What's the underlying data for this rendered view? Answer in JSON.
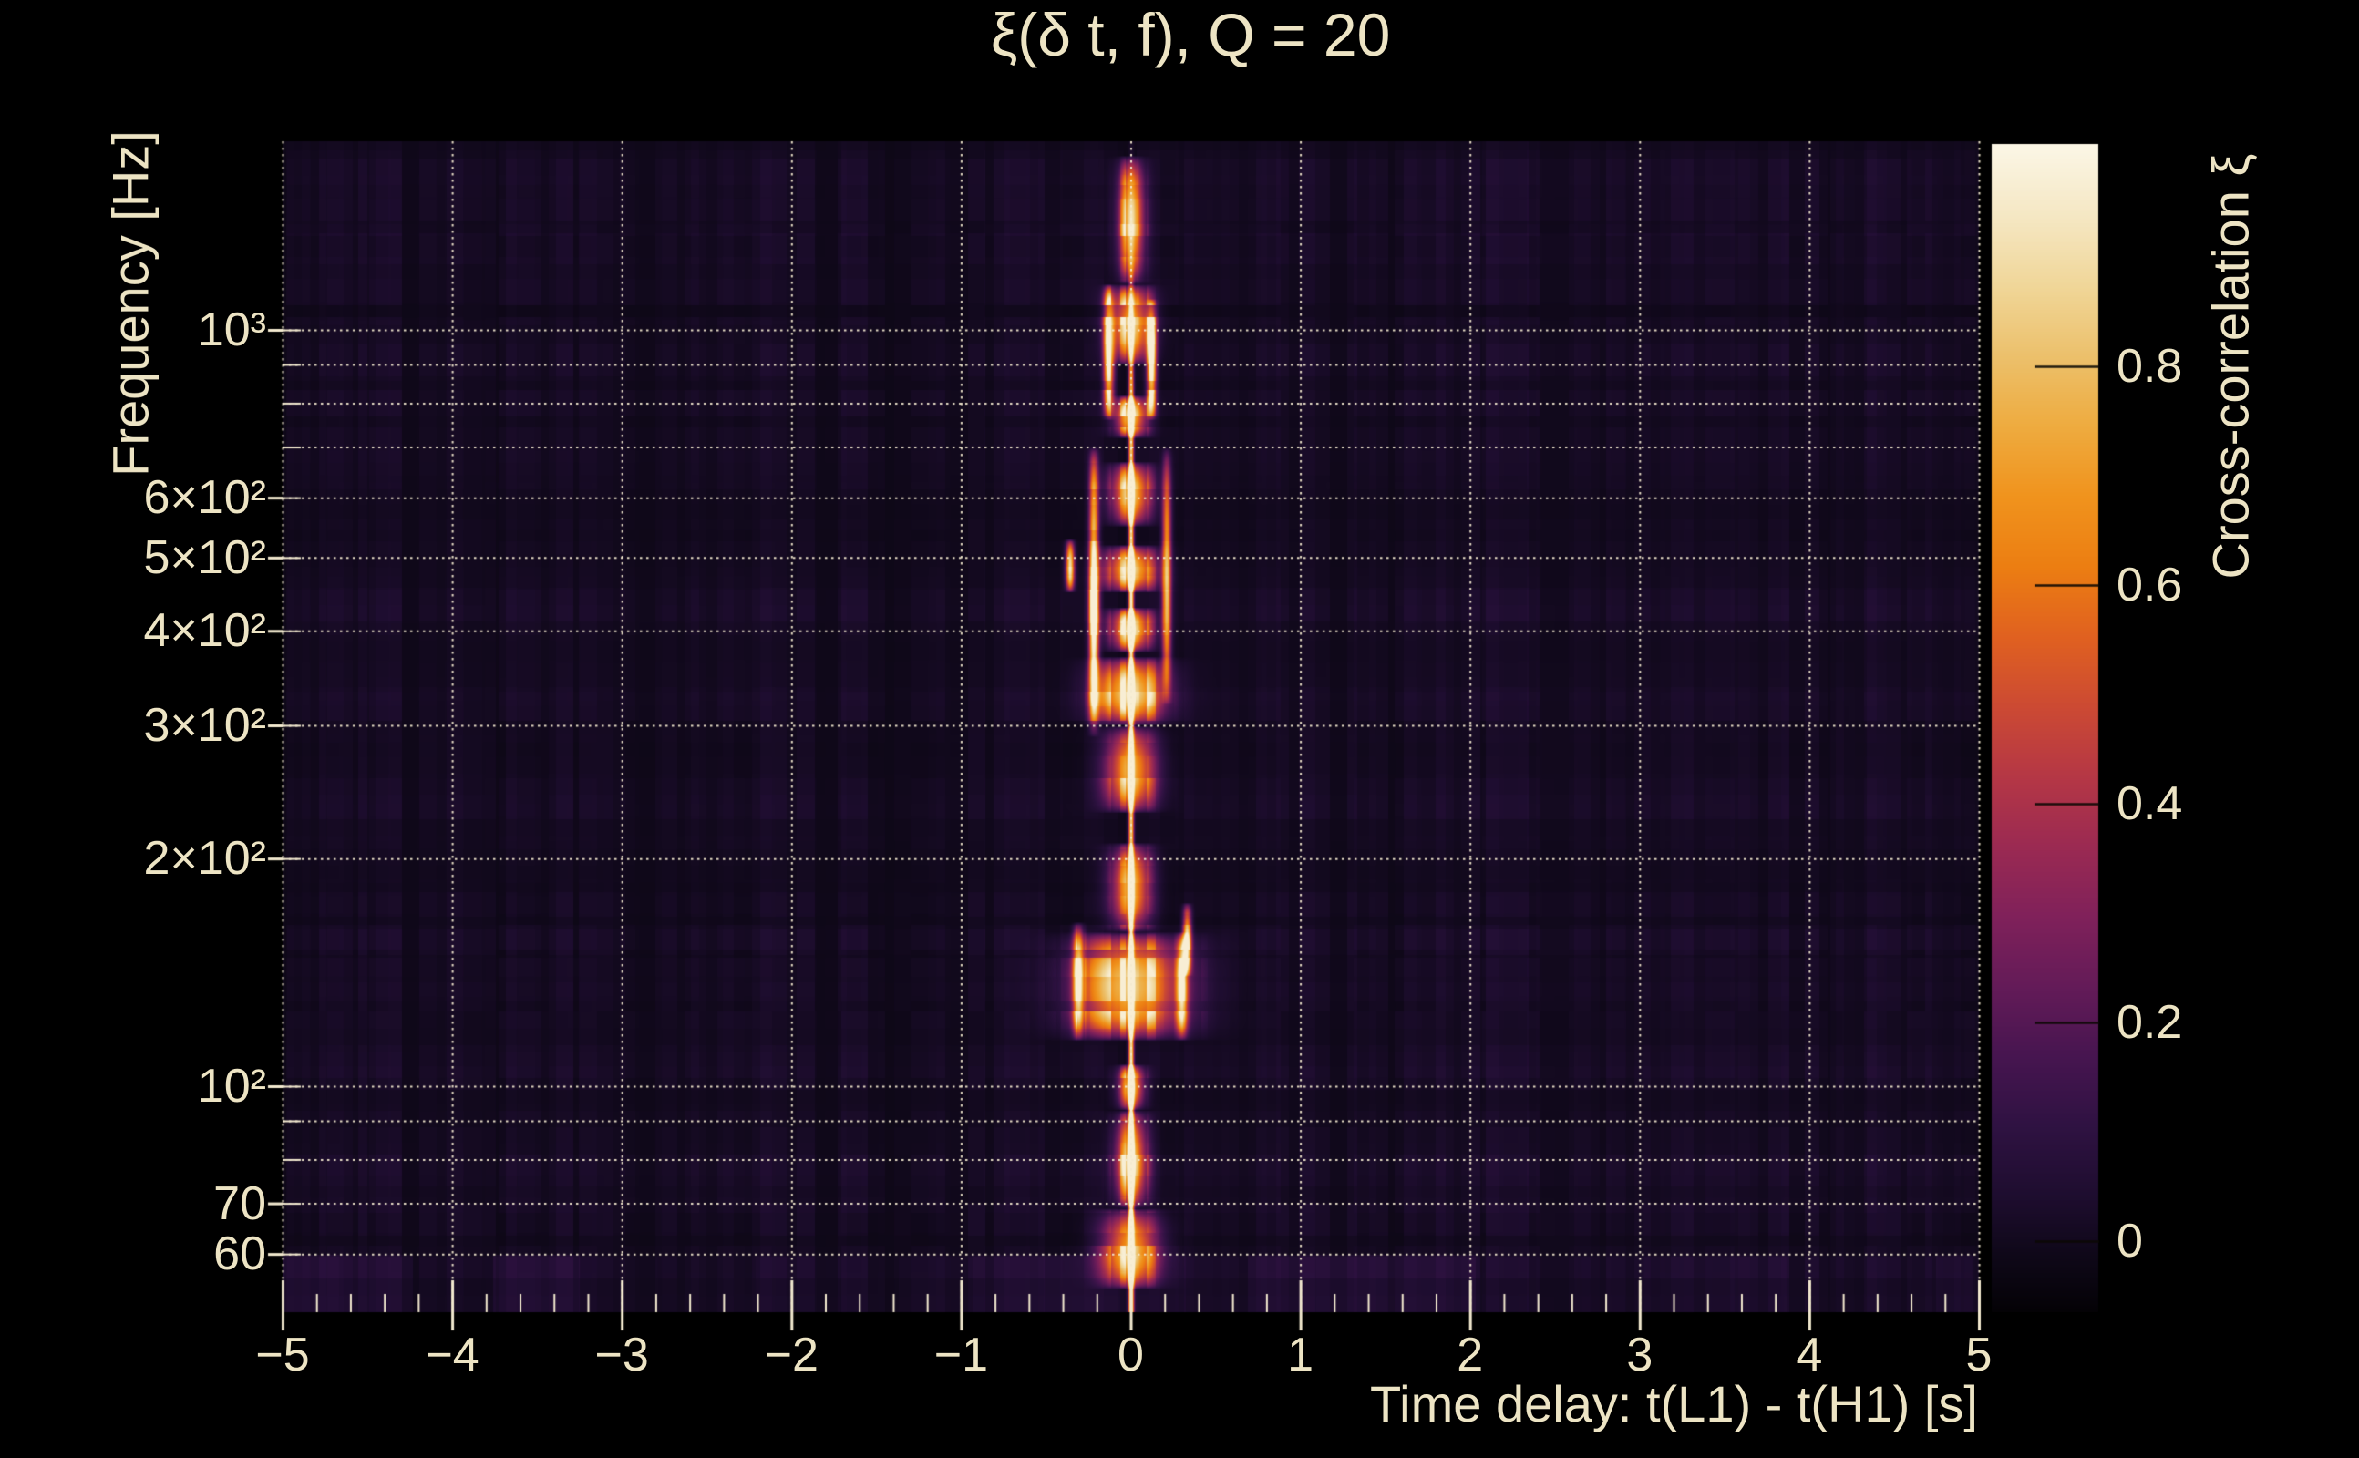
{
  "figure": {
    "background": "#000000",
    "text_color": "#ede4c4",
    "grid_color": "#f2e9cf"
  },
  "chart_data": {
    "type": "heatmap",
    "title": "ξ(δ t, f), Q = 20",
    "xlabel": "Time delay: t(L1) - t(H1) [s]",
    "ylabel": "Frequency [Hz]",
    "colorbar_label": "Cross-correlation ξ",
    "x_axis": {
      "min": -5,
      "max": 5,
      "unit": "s",
      "minor_tick_step": 0.2,
      "ticks": [
        {
          "v": -5,
          "label": "−5"
        },
        {
          "v": -4,
          "label": "−4"
        },
        {
          "v": -3,
          "label": "−3"
        },
        {
          "v": -2,
          "label": "−2"
        },
        {
          "v": -1,
          "label": "−1"
        },
        {
          "v": 0,
          "label": "0"
        },
        {
          "v": 1,
          "label": "1"
        },
        {
          "v": 2,
          "label": "2"
        },
        {
          "v": 3,
          "label": "3"
        },
        {
          "v": 4,
          "label": "4"
        },
        {
          "v": 5,
          "label": "5"
        }
      ]
    },
    "y_axis": {
      "scale": "log",
      "min_hz": 50,
      "max_hz": 1780,
      "unit": "Hz",
      "ticks": [
        {
          "v": 1000,
          "label": "10³"
        },
        {
          "v": 600,
          "label": "6×10²"
        },
        {
          "v": 500,
          "label": "5×10²"
        },
        {
          "v": 400,
          "label": "4×10²"
        },
        {
          "v": 300,
          "label": "3×10²"
        },
        {
          "v": 200,
          "label": "2×10²"
        },
        {
          "v": 100,
          "label": "10²"
        },
        {
          "v": 70,
          "label": "70"
        },
        {
          "v": 60,
          "label": "60"
        }
      ],
      "gridlines_hz": [
        60,
        70,
        80,
        90,
        100,
        200,
        300,
        400,
        500,
        600,
        700,
        800,
        900,
        1000
      ]
    },
    "colorbar": {
      "min": -0.065,
      "max": 1.0,
      "ticks": [
        {
          "v": 0.8,
          "label": "0.8"
        },
        {
          "v": 0.6,
          "label": "0.6"
        },
        {
          "v": 0.4,
          "label": "0.4"
        },
        {
          "v": 0.2,
          "label": "0.2"
        },
        {
          "v": 0.0,
          "label": "0"
        }
      ]
    },
    "colormap_stops": [
      [
        0.0,
        "#040206"
      ],
      [
        0.05,
        "#0f0819"
      ],
      [
        0.1,
        "#1e0d2f"
      ],
      [
        0.16,
        "#2f1242"
      ],
      [
        0.22,
        "#471550"
      ],
      [
        0.28,
        "#641b58"
      ],
      [
        0.34,
        "#80215a"
      ],
      [
        0.4,
        "#9b2a52"
      ],
      [
        0.46,
        "#b53745"
      ],
      [
        0.52,
        "#cc4a33"
      ],
      [
        0.58,
        "#e06120"
      ],
      [
        0.64,
        "#ec7e12"
      ],
      [
        0.7,
        "#f0931d"
      ],
      [
        0.76,
        "#eeab3f"
      ],
      [
        0.82,
        "#ecc06b"
      ],
      [
        0.88,
        "#f0d698"
      ],
      [
        0.94,
        "#f5e7c3"
      ],
      [
        1.0,
        "#fbf6e5"
      ]
    ],
    "signal": {
      "peak_delay_s": 0.0,
      "core_halfwidth_s": 0.016,
      "core_profile": [
        [
          52,
          0.98
        ],
        [
          60,
          0.98
        ],
        [
          70,
          0.95
        ],
        [
          90,
          0.9
        ],
        [
          100,
          0.92
        ],
        [
          115,
          0.85
        ],
        [
          150,
          0.86
        ],
        [
          200,
          0.8
        ],
        [
          260,
          0.82
        ],
        [
          320,
          0.85
        ],
        [
          400,
          0.9
        ],
        [
          480,
          0.92
        ],
        [
          520,
          0.85
        ],
        [
          600,
          0.78
        ],
        [
          700,
          0.78
        ],
        [
          780,
          0.82
        ],
        [
          850,
          0.7
        ],
        [
          950,
          0.55
        ],
        [
          1050,
          0.45
        ],
        [
          1150,
          0.3
        ],
        [
          1250,
          0.18
        ],
        [
          1400,
          0.08
        ],
        [
          1800,
          0.03
        ]
      ],
      "halos": [
        [
          54,
          69,
          0.155,
          0.8
        ],
        [
          69,
          93,
          0.085,
          0.5
        ],
        [
          93,
          107,
          0.07,
          0.62
        ],
        [
          115,
          160,
          0.3,
          0.6
        ],
        [
          160,
          210,
          0.11,
          0.42
        ],
        [
          230,
          300,
          0.14,
          0.48
        ],
        [
          300,
          370,
          0.19,
          0.48
        ],
        [
          375,
          430,
          0.11,
          0.52
        ],
        [
          450,
          520,
          0.14,
          0.66
        ],
        [
          550,
          670,
          0.11,
          0.5
        ],
        [
          720,
          820,
          0.09,
          0.52
        ],
        [
          900,
          1150,
          0.11,
          0.35
        ],
        [
          1150,
          1700,
          0.07,
          0.16
        ]
      ],
      "streaks": [
        [
          -0.22,
          290,
          700,
          0.028,
          0.26
        ],
        [
          0.21,
          320,
          700,
          0.026,
          0.24
        ],
        [
          -0.31,
          115,
          165,
          0.03,
          0.3
        ],
        [
          0.3,
          115,
          160,
          0.03,
          0.26
        ],
        [
          -0.13,
          760,
          1150,
          0.03,
          0.22
        ],
        [
          0.12,
          760,
          1100,
          0.028,
          0.2
        ],
        [
          -0.36,
          450,
          530,
          0.025,
          0.22
        ],
        [
          0.33,
          140,
          175,
          0.025,
          0.2
        ]
      ]
    },
    "noise": {
      "base": 0.045,
      "col_amp": 0.052,
      "row_amp": 0.036,
      "bottom_band_amp": 0.06,
      "seed": 1337
    }
  }
}
